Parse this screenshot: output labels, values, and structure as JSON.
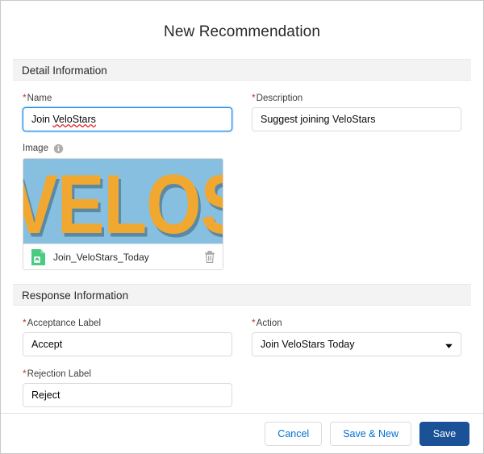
{
  "modal": {
    "title": "New Recommendation"
  },
  "sections": {
    "detail": {
      "heading": "Detail Information",
      "name": {
        "label": "Name",
        "required_marker": "*",
        "value": "Join VeloStars",
        "value_plain": "Join ",
        "value_misspelled": "VeloStars",
        "placeholder": ""
      },
      "description": {
        "label": "Description",
        "required_marker": "*",
        "value": "Suggest joining VeloStars",
        "placeholder": ""
      },
      "image": {
        "label": "Image",
        "info_icon": "info-icon",
        "preview_text": "VELOSTARS",
        "preview_bg": "#86bfe0",
        "preview_fg": "#f0a830",
        "file_icon": "file-icon",
        "file_name": "Join_VeloStars_Today",
        "delete_icon": "trash-icon"
      }
    },
    "response": {
      "heading": "Response Information",
      "acceptance": {
        "label": "Acceptance Label",
        "required_marker": "*",
        "value": "Accept",
        "placeholder": ""
      },
      "action": {
        "label": "Action",
        "required_marker": "*",
        "value": "Join VeloStars Today",
        "chevron_icon": "chevron-down-icon"
      },
      "rejection": {
        "label": "Rejection Label",
        "required_marker": "*",
        "value": "Reject",
        "placeholder": ""
      }
    }
  },
  "footer": {
    "cancel_label": "Cancel",
    "save_new_label": "Save & New",
    "save_label": "Save"
  },
  "colors": {
    "primary_button": "#1b5297",
    "link_text": "#0070d2",
    "required_marker": "#c23934",
    "focus_border": "#1589ee",
    "section_band": "#f3f3f3"
  }
}
